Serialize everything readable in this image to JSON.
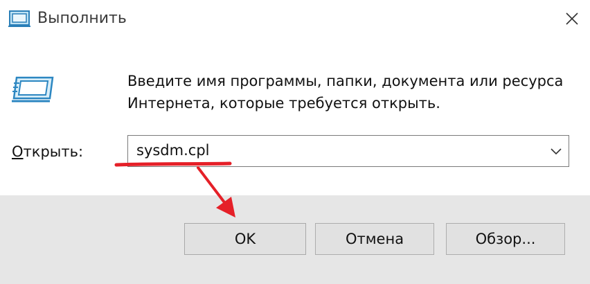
{
  "window": {
    "title": "Выполнить",
    "close_icon": "close-icon",
    "title_icon": "run-icon"
  },
  "content": {
    "app_icon": "run-program-icon",
    "prompt_line1": "Введите имя программы, папки, документа или ресурса",
    "prompt_line2": "Интернета, которые требуется открыть.",
    "open_label_accel": "О",
    "open_label_rest": "ткрыть:",
    "input_value": "sysdm.cpl",
    "dropdown_icon": "chevron-down-icon"
  },
  "buttons": {
    "ok_label": "OK",
    "cancel_label": "Отмена",
    "browse_label": "Обзор..."
  },
  "annotation": {
    "color": "#e52028",
    "type": "underline-and-arrow"
  }
}
